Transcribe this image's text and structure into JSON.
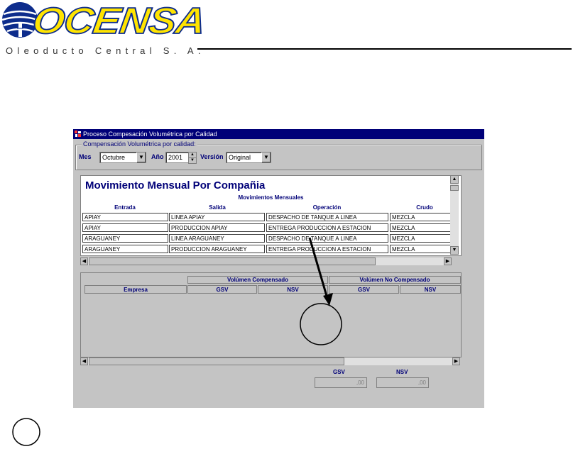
{
  "logo": {
    "name": "OCENSA",
    "subtitle": "Oleoducto Central S. A."
  },
  "window": {
    "title": "Proceso Compesación Volumétrica por Calidad",
    "group_label": "Compensación Volumétrica por calidad:",
    "mes_label": "Mes",
    "mes_value": "Octubre",
    "anio_label": "Año",
    "anio_value": "2001",
    "version_label": "Versión",
    "version_value": "Original"
  },
  "upper": {
    "title": "Movimiento Mensual Por Compañia",
    "subtitle": "Movimientos Mensuales",
    "columns": [
      "Entrada",
      "Salida",
      "Operación",
      "Crudo"
    ],
    "rows": [
      [
        "APIAY",
        "LINEA APIAY",
        "DESPACHO DE TANQUE A LINEA",
        "MEZCLA"
      ],
      [
        "APIAY",
        "PRODUCCION APIAY",
        "ENTREGA PRODUCCION A ESTACION",
        "MEZCLA"
      ],
      [
        "ARAGUANEY",
        "LINEA ARAGUANEY",
        "DESPACHO DE TANQUE A LINEA",
        "MEZCLA"
      ],
      [
        "ARAGUANEY",
        "PRODUCCION ARAGUANEY",
        "ENTREGA PRODUCCION A ESTACION",
        "MEZCLA"
      ]
    ]
  },
  "lower": {
    "group_compensado": "Volúmen Compensado",
    "group_no_compensado": "Volúmen No Compensado",
    "col_empresa": "Empresa",
    "col_gsv": "GSV",
    "col_nsv": "NSV",
    "col_gsv2": "GSV",
    "col_nsv2": "NSV"
  },
  "totals": {
    "gsv_label": "GSV",
    "gsv_value": ",00",
    "nsv_label": "NSV",
    "nsv_value": ",00"
  },
  "colors": {
    "title_bar": "#000078",
    "logo_blue": "#0d2c8c",
    "logo_yellow": "#ffe400",
    "panel_gray": "#c4c4c4"
  },
  "icons": [
    "globe-logo-icon",
    "window-app-icon",
    "dropdown-arrow-icon",
    "spin-up-icon",
    "spin-down-icon",
    "scroll-arrow-icon"
  ]
}
